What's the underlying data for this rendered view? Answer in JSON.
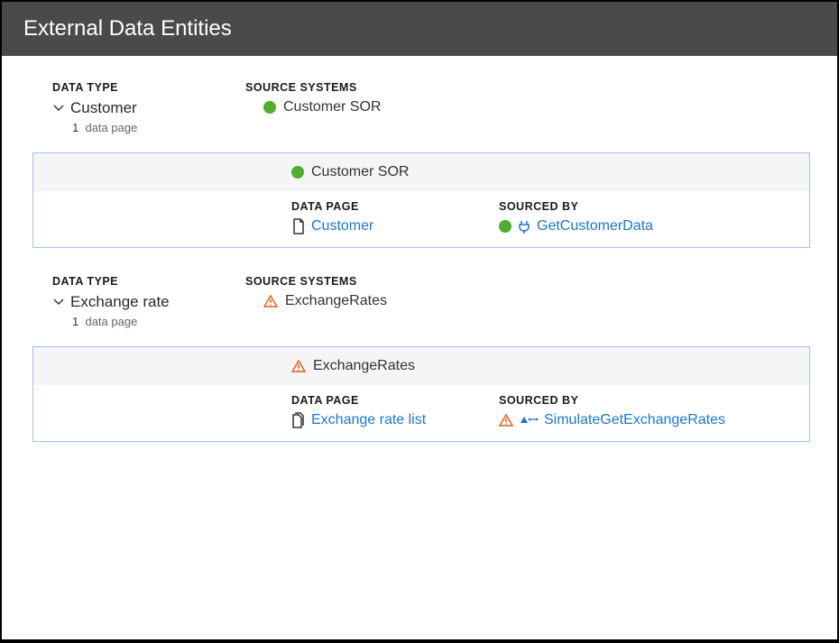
{
  "header": {
    "title": "External Data Entities"
  },
  "labels": {
    "dataType": "DATA TYPE",
    "sourceSystems": "SOURCE SYSTEMS",
    "dataPage": "DATA PAGE",
    "sourcedBy": "SOURCED BY",
    "dataPageUnit": "data page"
  },
  "entities": [
    {
      "name": "Customer",
      "pageCount": "1",
      "source": {
        "label": "Customer SOR",
        "status": "ok"
      },
      "detail": {
        "sourceLabel": "Customer SOR",
        "sourceStatus": "ok",
        "dataPage": {
          "label": "Customer",
          "iconType": "single"
        },
        "sourcedBy": {
          "label": "GetCustomerData",
          "status": "ok",
          "iconType": "connector"
        }
      }
    },
    {
      "name": "Exchange rate",
      "pageCount": "1",
      "source": {
        "label": "ExchangeRates",
        "status": "warning"
      },
      "detail": {
        "sourceLabel": "ExchangeRates",
        "sourceStatus": "warning",
        "dataPage": {
          "label": "Exchange rate list",
          "iconType": "multi"
        },
        "sourcedBy": {
          "label": "SimulateGetExchangeRates",
          "status": "warning",
          "iconType": "activity"
        }
      }
    }
  ]
}
